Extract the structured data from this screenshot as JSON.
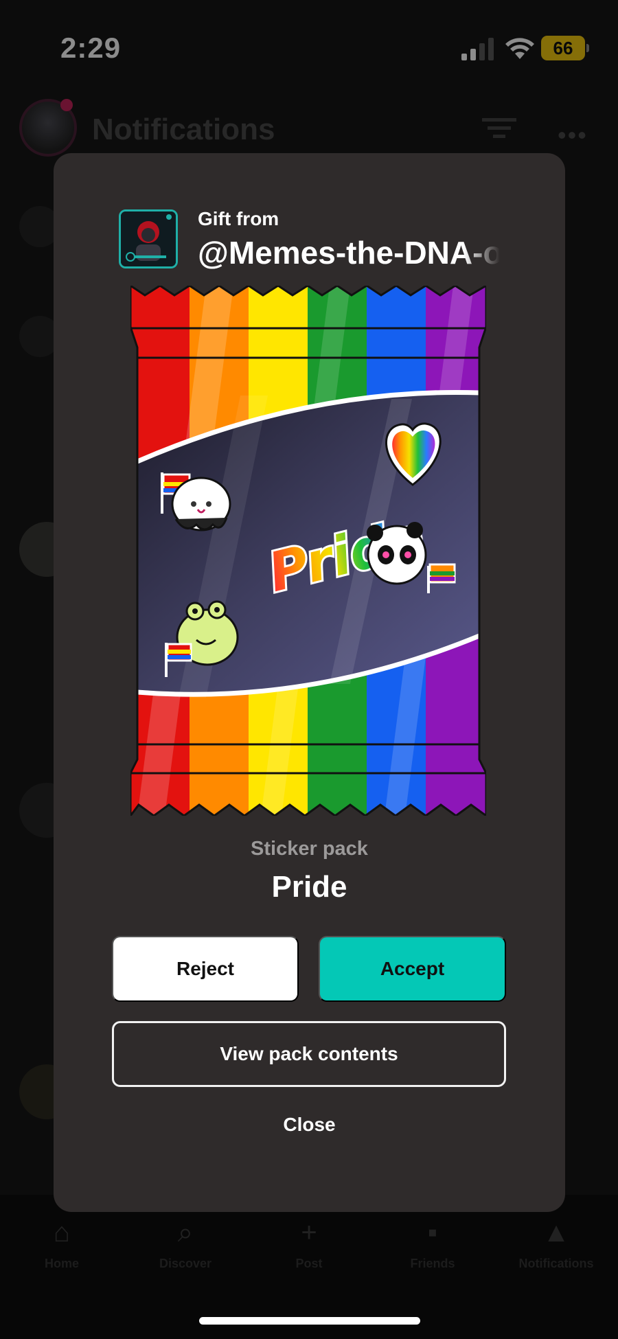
{
  "status_bar": {
    "time": "2:29",
    "battery": "66"
  },
  "background": {
    "title": "Notifications",
    "more": "•••",
    "tabs": [
      {
        "label": "Home",
        "icon": "home-icon"
      },
      {
        "label": "Discover",
        "icon": "search-icon"
      },
      {
        "label": "Post",
        "icon": "plus-icon"
      },
      {
        "label": "Friends",
        "icon": "chat-icon"
      },
      {
        "label": "Notifications",
        "icon": "bell-icon"
      }
    ]
  },
  "modal": {
    "gift_from_label": "Gift from",
    "gift_user": "@Memes-the-DNA-of-the-soul",
    "pack_type": "Sticker pack",
    "pack_name": "Pride",
    "art_text": "Pride",
    "reject_label": "Reject",
    "accept_label": "Accept",
    "view_label": "View pack contents",
    "close_label": "Close"
  },
  "colors": {
    "accent": "#04c8b6",
    "modal_bg": "#2f2b2b",
    "battery": "#f2c80f",
    "rainbow": [
      "#e3120f",
      "#ff8a00",
      "#ffe600",
      "#1a9a2e",
      "#1560f0",
      "#8d16b8"
    ]
  }
}
